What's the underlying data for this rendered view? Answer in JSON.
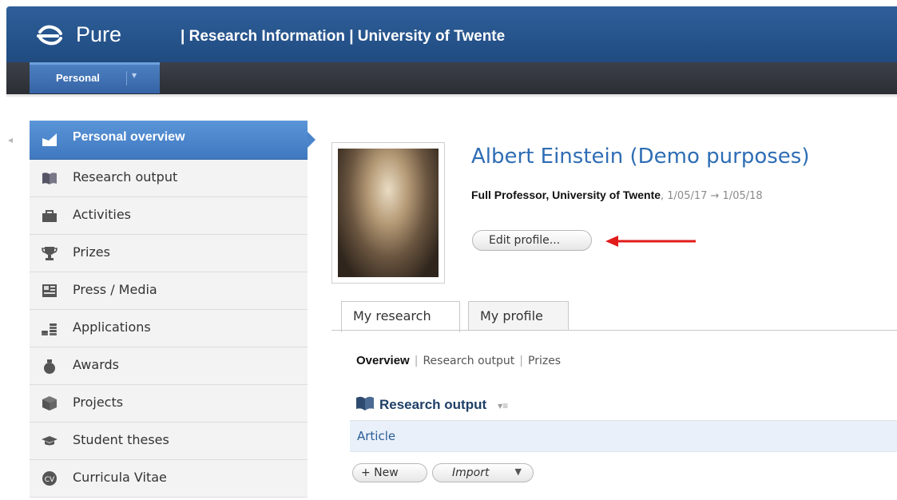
{
  "header": {
    "logo_text": "Pure",
    "title": "| Research Information | University of Twente",
    "nav_tab": "Personal",
    "nav_tab_caret": "▾",
    "accent_color": "#2f5f9a"
  },
  "sidebar": {
    "collapse_glyph": "◂",
    "items": [
      {
        "label": "Personal overview",
        "icon": "personal-overview-icon",
        "active": true
      },
      {
        "label": "Research output",
        "icon": "book-icon"
      },
      {
        "label": "Activities",
        "icon": "briefcase-icon"
      },
      {
        "label": "Prizes",
        "icon": "trophy-icon"
      },
      {
        "label": "Press / Media",
        "icon": "newspaper-icon"
      },
      {
        "label": "Applications",
        "icon": "coins-icon"
      },
      {
        "label": "Awards",
        "icon": "money-bag-icon"
      },
      {
        "label": "Projects",
        "icon": "cube-icon"
      },
      {
        "label": "Student theses",
        "icon": "graduation-cap-icon"
      },
      {
        "label": "Curricula Vitae",
        "icon": "cv-icon"
      }
    ]
  },
  "profile": {
    "name": "Albert Einstein (Demo purposes)",
    "role": "Full Professor, University of Twente",
    "dates": ", 1/05/17 → 1/05/18",
    "edit_button": "Edit profile..."
  },
  "tabs": [
    {
      "label": "My research",
      "active": true
    },
    {
      "label": "My profile",
      "active": false
    }
  ],
  "subnav": {
    "current": "Overview",
    "separator": "|",
    "links": [
      "Research output",
      "Prizes"
    ]
  },
  "research_output": {
    "heading": "Research output",
    "menu_glyph": "▾≡",
    "row_label": "Article",
    "new_button": "+ New",
    "import_button": "Import",
    "import_caret": "▼"
  }
}
